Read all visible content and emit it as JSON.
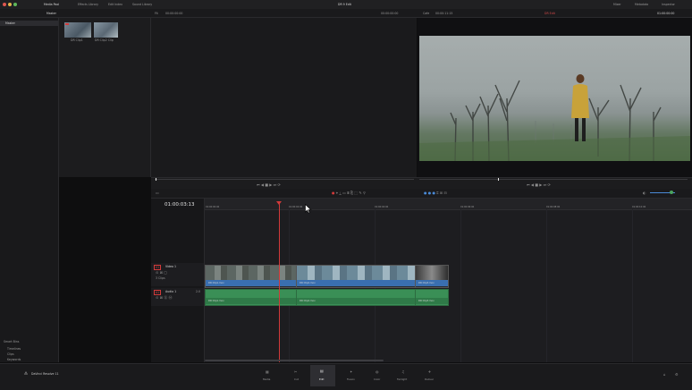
{
  "window": {
    "title": "DR 9 Edit"
  },
  "toolbar": {
    "media_pool": "Media Pool",
    "effects_library": "Effects Library",
    "edit_index": "Edit Index",
    "sound_library": "Sound Library",
    "mixer": "Mixer",
    "metadata": "Metadata",
    "inspector": "Inspector"
  },
  "media_pool": {
    "bin_selector": "Master",
    "master_bin": "Master",
    "clips": [
      {
        "label": "DR Clip1"
      },
      {
        "label": "DR Clip2 Clip"
      }
    ]
  },
  "source_viewer": {
    "timecode": "00:00:00:00",
    "zoom": "Fit"
  },
  "timeline_viewer": {
    "source_tc": "00:00:00:00",
    "name": "Cafe",
    "duration": "00:00:11:15",
    "timeline_name": "DR Edit",
    "timecode": "01:00:00:00"
  },
  "timeline": {
    "current_tc": "01:00:03:13",
    "ruler_marks": [
      "01:00:00:00",
      "01:00:02:00",
      "01:00:04:00",
      "01:00:06:00",
      "01:00:08:00",
      "01:00:10:00",
      "01:00:12:00"
    ],
    "video_track": {
      "name": "Video 1",
      "id": "V1",
      "sub": "3 Clips"
    },
    "audio_track": {
      "name": "Audio 1",
      "id": "A1",
      "level": "2.0"
    },
    "clip_labels": {
      "c1": "DR Clip1.mov",
      "c2": "DR Clip2.mov",
      "c3": "DR Clip3.mov"
    }
  },
  "smart_bins": {
    "header": "Smart Bins",
    "items": [
      "Timelines",
      "Clips",
      "Keywords"
    ]
  },
  "app": {
    "name": "DaVinci Resolve 11"
  },
  "pages": [
    "Media",
    "Cut",
    "Edit",
    "Fusion",
    "Color",
    "Fairlight",
    "Deliver"
  ],
  "colors": {
    "playhead": "#d23a3a",
    "video_clip": "#3a6fb0",
    "audio_clip": "#3a8f56",
    "active_page": "#e8e8e8"
  }
}
